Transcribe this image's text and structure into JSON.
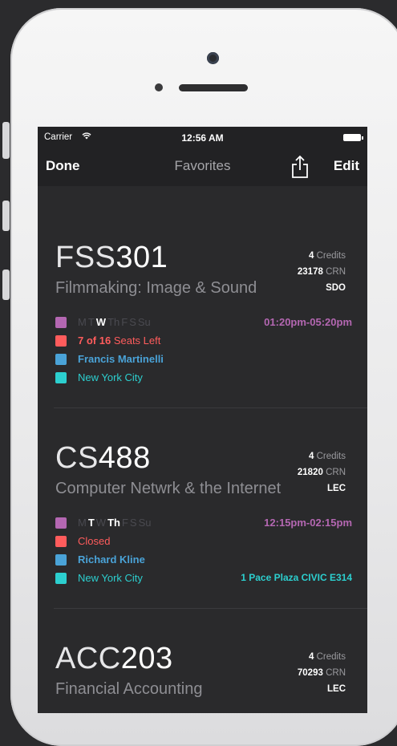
{
  "status_bar": {
    "carrier": "Carrier",
    "wifi": "wifi-icon",
    "time": "12:56 AM"
  },
  "nav": {
    "done": "Done",
    "title": "Favorites",
    "share_icon": "share-icon",
    "edit": "Edit"
  },
  "colors": {
    "purple": "#b467b2",
    "red": "#ff5c5c",
    "blue": "#4aa3d8",
    "teal": "#2ccfcf"
  },
  "courses": [
    {
      "dept": "FSS",
      "number": "301",
      "name": "Filmmaking: Image & Sound",
      "credits_value": "4",
      "credits_unit": "Credits",
      "crn_value": "23178",
      "crn_unit": "CRN",
      "type": "SDO",
      "days": [
        {
          "label": "M",
          "active": false
        },
        {
          "label": "T",
          "active": false
        },
        {
          "label": "W",
          "active": true
        },
        {
          "label": "Th",
          "active": false
        },
        {
          "label": "F",
          "active": false
        },
        {
          "label": "S",
          "active": false
        },
        {
          "label": "Su",
          "active": false
        }
      ],
      "time": "01:20pm-05:20pm",
      "seats_bold": "7 of 16",
      "seats_text": "Seats Left",
      "instructor": "Francis Martinelli",
      "campus": "New York City",
      "room": ""
    },
    {
      "dept": "CS",
      "number": "488",
      "name": "Computer Netwrk & the Internet",
      "credits_value": "4",
      "credits_unit": "Credits",
      "crn_value": "21820",
      "crn_unit": "CRN",
      "type": "LEC",
      "days": [
        {
          "label": "M",
          "active": false
        },
        {
          "label": "T",
          "active": true
        },
        {
          "label": "W",
          "active": false
        },
        {
          "label": "Th",
          "active": true
        },
        {
          "label": "F",
          "active": false
        },
        {
          "label": "S",
          "active": false
        },
        {
          "label": "Su",
          "active": false
        }
      ],
      "time": "12:15pm-02:15pm",
      "seats_bold": "",
      "seats_text": "Closed",
      "instructor": "Richard Kline",
      "campus": "New York City",
      "room": "1 Pace Plaza CIVIC E314"
    },
    {
      "dept": "ACC",
      "number": "203",
      "name": "Financial Accounting",
      "credits_value": "4",
      "credits_unit": "Credits",
      "crn_value": "70293",
      "crn_unit": "CRN",
      "type": "LEC"
    }
  ]
}
